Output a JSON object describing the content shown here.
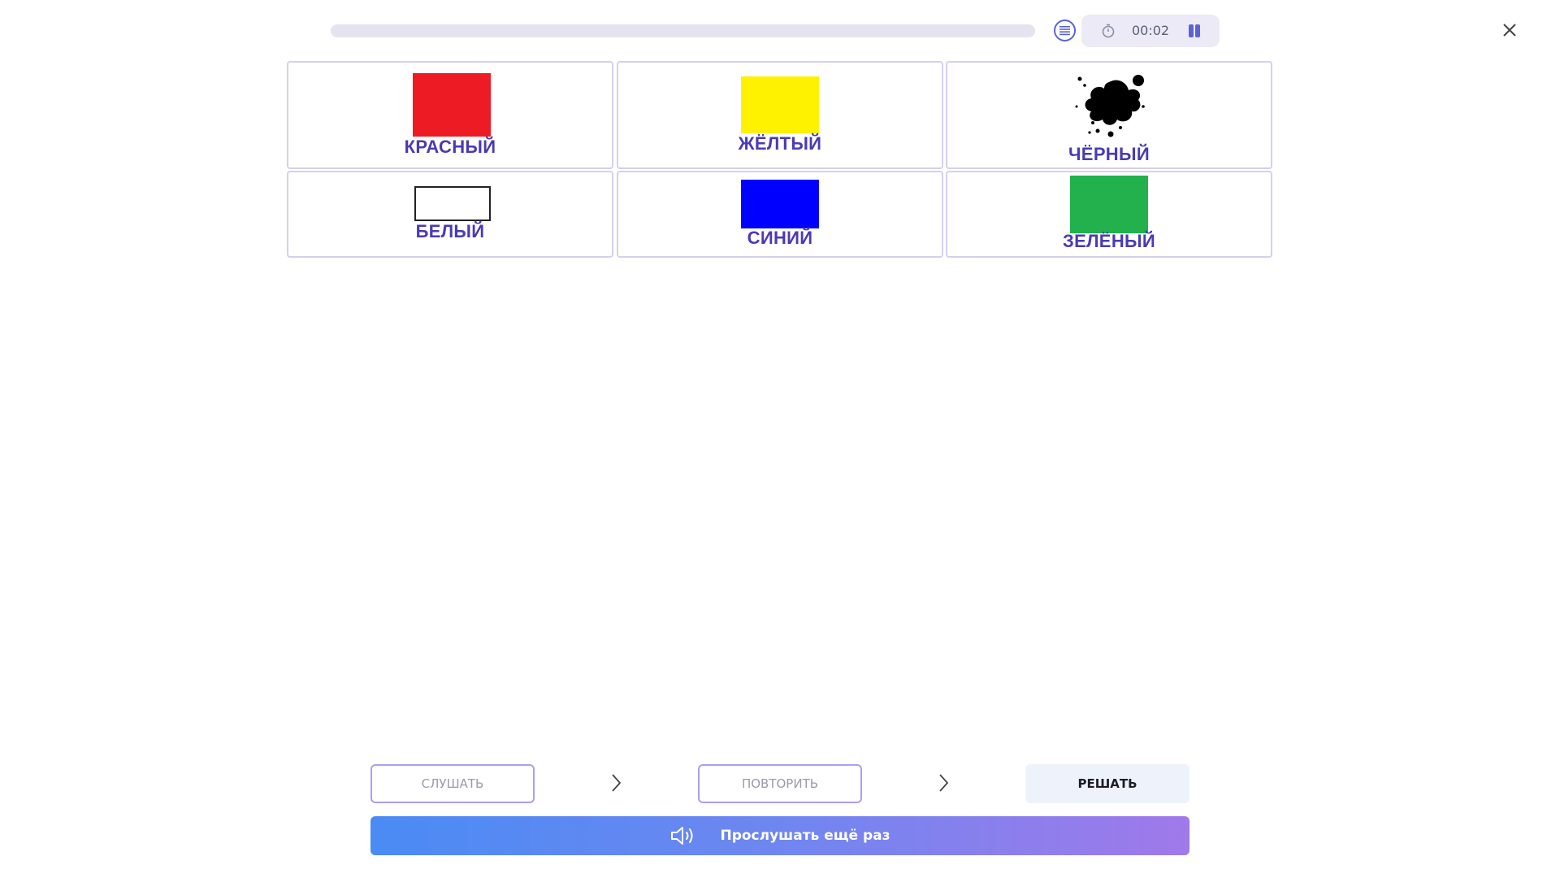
{
  "header": {
    "progress": 0,
    "timer": "00:02",
    "icons": {
      "list": "list-icon",
      "clock": "stopwatch-icon",
      "pause": "pause-icon",
      "close": "close-icon"
    }
  },
  "cards": [
    {
      "label": "КРАСНЫЙ",
      "color": "#ed1c24",
      "kind": "rect"
    },
    {
      "label": "ЖЁЛТЫЙ",
      "color": "#fff200",
      "kind": "rect"
    },
    {
      "label": "ЧЁРНЫЙ",
      "color": "#000000",
      "kind": "blot"
    },
    {
      "label": "БЕЛЫЙ",
      "color": "#ffffff",
      "kind": "outline-rect"
    },
    {
      "label": "СИНИЙ",
      "color": "#0000ff",
      "kind": "rect"
    },
    {
      "label": "ЗЕЛЁНЫЙ",
      "color": "#22b14c",
      "kind": "rect"
    }
  ],
  "steps": [
    {
      "label": "СЛУШАТЬ",
      "state": "done"
    },
    {
      "label": "ПОВТОРИТЬ",
      "state": "done"
    },
    {
      "label": "РЕШАТЬ",
      "state": "active"
    }
  ],
  "listen_again": {
    "label": "Прослушать ещё раз",
    "icon": "speaker-icon"
  },
  "colors": {
    "accent": "#5a63d6",
    "label_text": "#4a3ab4",
    "card_border": "#d4d1ec"
  }
}
